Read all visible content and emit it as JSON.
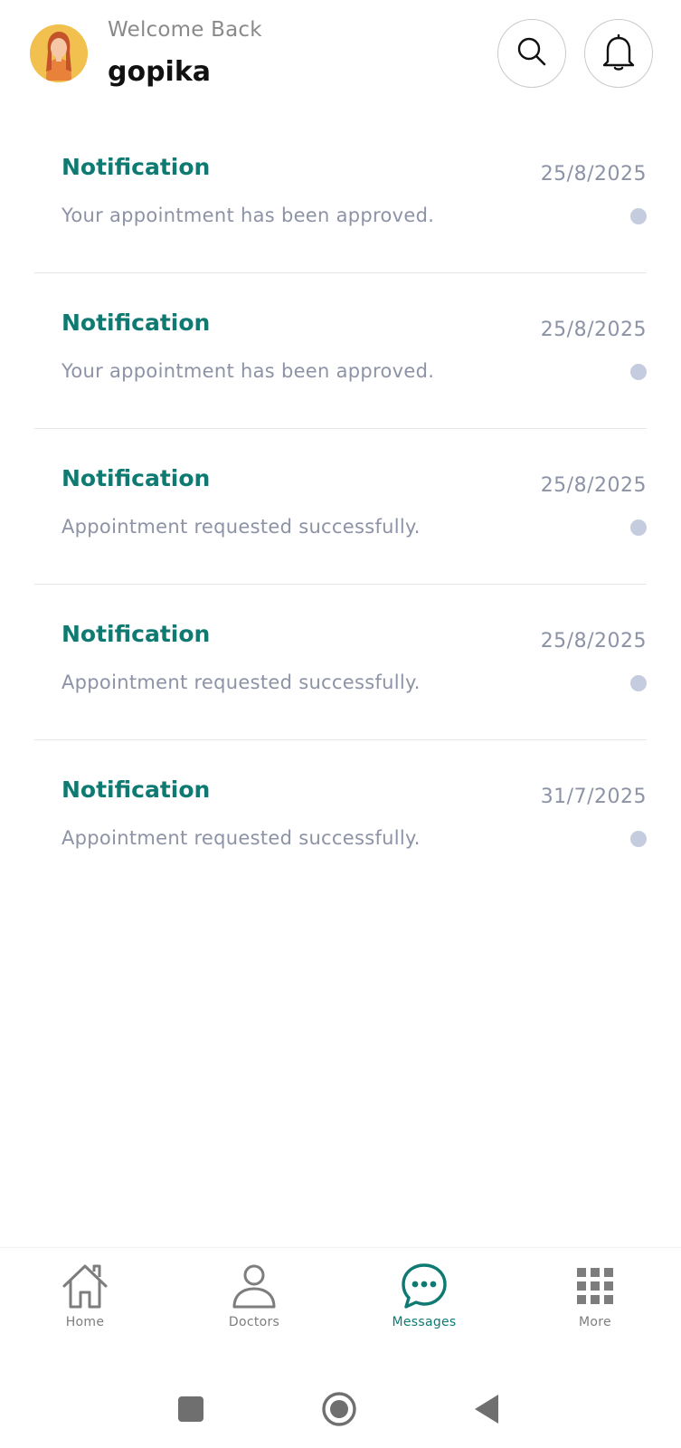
{
  "header": {
    "welcome_text": "Welcome Back",
    "user_name": "gopika",
    "search_icon": "search-icon",
    "bell_icon": "bell-icon"
  },
  "notifications": [
    {
      "title": "Notification",
      "date": "25/8/2025",
      "message": "Your appointment has been approved."
    },
    {
      "title": "Notification",
      "date": "25/8/2025",
      "message": "Your appointment has been approved."
    },
    {
      "title": "Notification",
      "date": "25/8/2025",
      "message": "Appointment requested successfully."
    },
    {
      "title": "Notification",
      "date": "25/8/2025",
      "message": "Appointment requested successfully."
    },
    {
      "title": "Notification",
      "date": "31/7/2025",
      "message": "Appointment requested successfully."
    }
  ],
  "bottom_nav": {
    "items": [
      {
        "label": "Home",
        "icon": "home-icon"
      },
      {
        "label": "Doctors",
        "icon": "person-icon"
      },
      {
        "label": "Messages",
        "icon": "chat-bubble-icon"
      },
      {
        "label": "More",
        "icon": "grid-icon"
      }
    ],
    "active": "Messages"
  },
  "colors": {
    "accent": "#0e7a72",
    "muted_text": "#8d93a6",
    "dot": "#c5cce0"
  }
}
